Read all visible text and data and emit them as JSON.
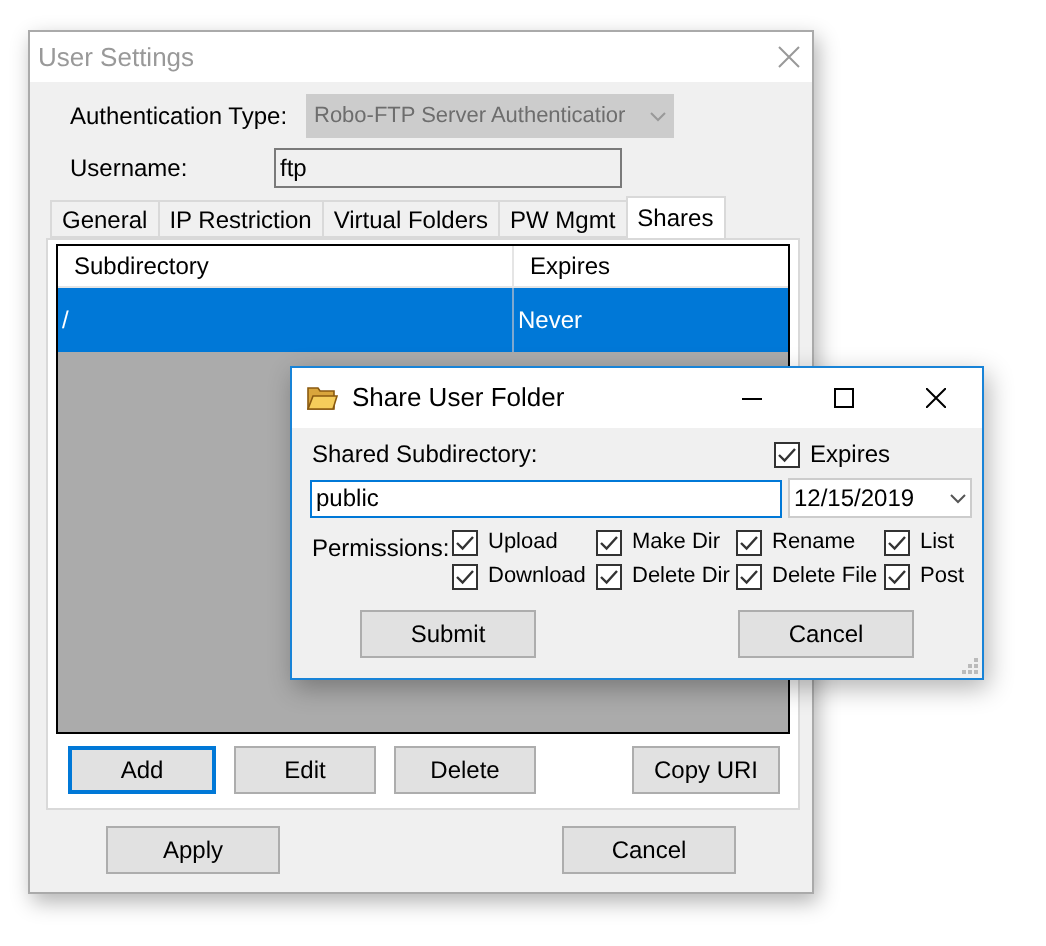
{
  "main_window": {
    "title": "User Settings",
    "authentication_type": {
      "label": "Authentication Type:",
      "value": "Robo-FTP Server Authenticatior",
      "disabled": true
    },
    "username": {
      "label": "Username:",
      "value": "ftp"
    },
    "tabs": [
      {
        "label": "General",
        "selected": false
      },
      {
        "label": "IP Restriction",
        "selected": false
      },
      {
        "label": "Virtual Folders",
        "selected": false
      },
      {
        "label": "PW Mgmt",
        "selected": false
      },
      {
        "label": "Shares",
        "selected": true
      }
    ],
    "shares_table": {
      "columns": [
        "Subdirectory",
        "Expires"
      ],
      "rows": [
        {
          "cells": [
            "/",
            "Never"
          ],
          "selected": true
        }
      ]
    },
    "buttons": [
      {
        "label": "Add",
        "focused": true
      },
      {
        "label": "Edit",
        "focused": false
      },
      {
        "label": "Delete",
        "focused": false
      },
      {
        "label": "Copy URI",
        "focused": false
      }
    ],
    "footer_buttons": [
      "Apply",
      "Cancel"
    ]
  },
  "dialog": {
    "title": "Share User Folder",
    "subdirectory": {
      "label": "Shared Subdirectory:",
      "value": "public"
    },
    "expires": {
      "label": "Expires",
      "checked": true
    },
    "date": "12/15/2019",
    "permissions_label": "Permissions:",
    "permissions": [
      {
        "label": "Upload",
        "checked": true
      },
      {
        "label": "Download",
        "checked": true
      },
      {
        "label": "Make Dir",
        "checked": true
      },
      {
        "label": "Delete Dir",
        "checked": true
      },
      {
        "label": "Rename",
        "checked": true
      },
      {
        "label": "Delete File",
        "checked": true
      },
      {
        "label": "List",
        "checked": true
      },
      {
        "label": "Post",
        "checked": true
      }
    ],
    "buttons": [
      "Submit",
      "Cancel"
    ]
  }
}
